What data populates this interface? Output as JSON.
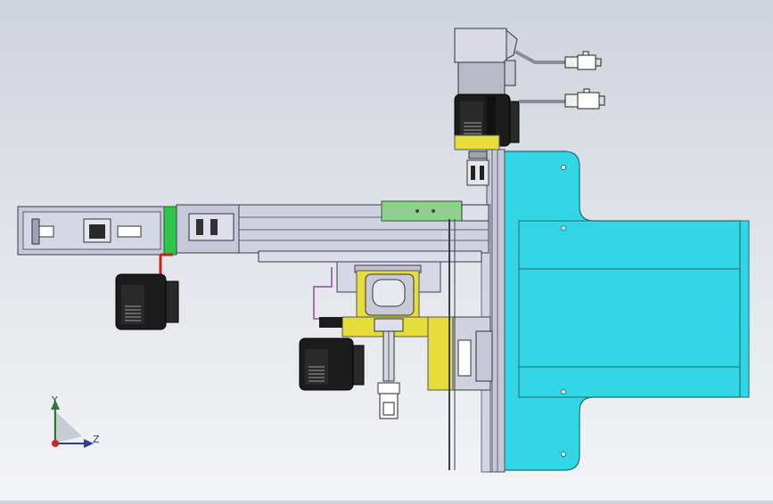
{
  "viewport": {
    "kind": "cad-assembly-view",
    "background_top": "#cfd3dc",
    "background_bottom": "#f3f4f6"
  },
  "triad": {
    "y_label": "Y",
    "z_label": "Z",
    "y_color": "#2f7a2f",
    "z_color": "#2b3a9c",
    "origin_color": "#d22020"
  },
  "colors": {
    "plate_cyan": "#32d6e4",
    "frame_gray": "#c6c8d8",
    "frame_dark": "#8e90a6",
    "bracket_yellow": "#e6dd3a",
    "slider_green": "#8fd08f",
    "coupler_green": "#2ec44a",
    "motor_black": "#1c1c1c",
    "cable_red": "#d22020",
    "cable_purple": "#a070c0"
  }
}
